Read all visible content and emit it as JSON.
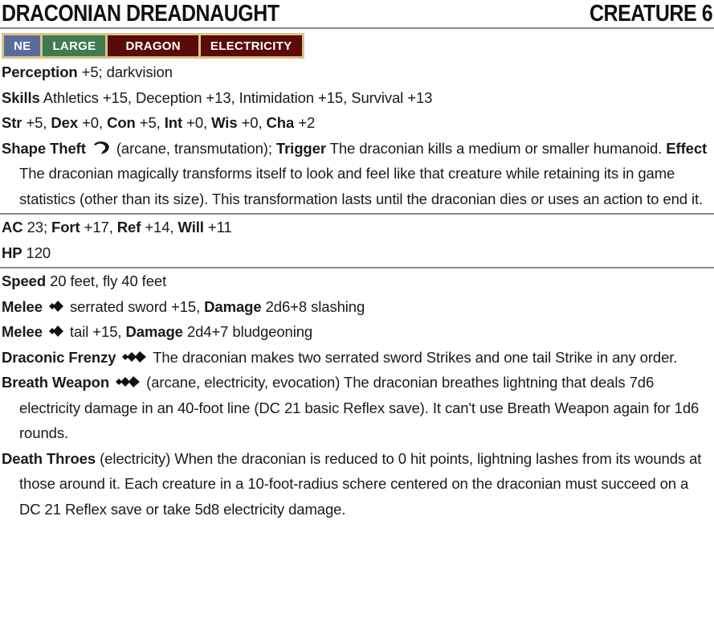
{
  "header": {
    "name": "DRACONIAN DREADNAUGHT",
    "level": "CREATURE 6"
  },
  "traits": [
    {
      "label": "NE",
      "color": "#5a6c9c"
    },
    {
      "label": "LARGE",
      "color": "#3f7a52"
    },
    {
      "label": "DRAGON",
      "color": "#5b0a0a"
    },
    {
      "label": "ELECTRICITY",
      "color": "#5b0a0a"
    }
  ],
  "perception": {
    "label": "Perception",
    "text": " +5; darkvision"
  },
  "skills": {
    "label": "Skills",
    "text": " Athletics +15, Deception +13, Intimidation +15, Survival +13"
  },
  "abilities": [
    {
      "label": "Str",
      "value": " +5, "
    },
    {
      "label": "Dex",
      "value": " +0, "
    },
    {
      "label": "Con",
      "value": " +5, "
    },
    {
      "label": "Int",
      "value": " +0, "
    },
    {
      "label": "Wis",
      "value": " +0, "
    },
    {
      "label": "Cha",
      "value": " +2"
    }
  ],
  "shape_theft": {
    "label": "Shape Theft",
    "traits": " (arcane, transmutation); ",
    "trigger_label": "Trigger",
    "trigger_text": " The draconian kills a medium or smaller humanoid. ",
    "effect_label": "Effect",
    "effect_text": " The draconian magically transforms itself to look and feel like that creature while retaining its in game statistics (other than its size). This transformation lasts until the draconian dies or uses an action to end it."
  },
  "defense": {
    "ac_label": "AC",
    "ac_text": " 23; ",
    "fort_label": "Fort",
    "fort_text": " +17, ",
    "ref_label": "Ref",
    "ref_text": " +14, ",
    "will_label": "Will",
    "will_text": " +11",
    "hp_label": "HP",
    "hp_text": " 120"
  },
  "speed": {
    "label": "Speed",
    "text": " 20 feet, fly 40 feet"
  },
  "melee": [
    {
      "label": "Melee",
      "text": " serrated sword +15, ",
      "damage_label": "Damage",
      "damage_text": " 2d6+8 slashing"
    },
    {
      "label": "Melee",
      "text": " tail +15, ",
      "damage_label": "Damage",
      "damage_text": " 2d4+7 bludgeoning"
    }
  ],
  "draconic_frenzy": {
    "label": "Draconic Frenzy",
    "text": " The draconian makes two serrated sword Strikes and one tail Strike in any order."
  },
  "breath_weapon": {
    "label": "Breath Weapon",
    "text": " (arcane, electricity, evocation) The draconian breathes lightning that deals 7d6 electricity damage in an 40-foot line (DC 21 basic Reflex save). It can't use Breath Weapon again for 1d6 rounds."
  },
  "death_throes": {
    "label": "Death Throes",
    "text": " (electricity) When the draconian is reduced to 0 hit points, lightning lashes from its wounds at those around it. Each creature in a 10-foot-radius schere centered on the draconian must succeed on a DC 21 Reflex save or take 5d8 electricity damage."
  },
  "icons": {
    "reaction": "reaction-icon",
    "single_action": "single-action-icon",
    "two_actions": "two-actions-icon"
  }
}
